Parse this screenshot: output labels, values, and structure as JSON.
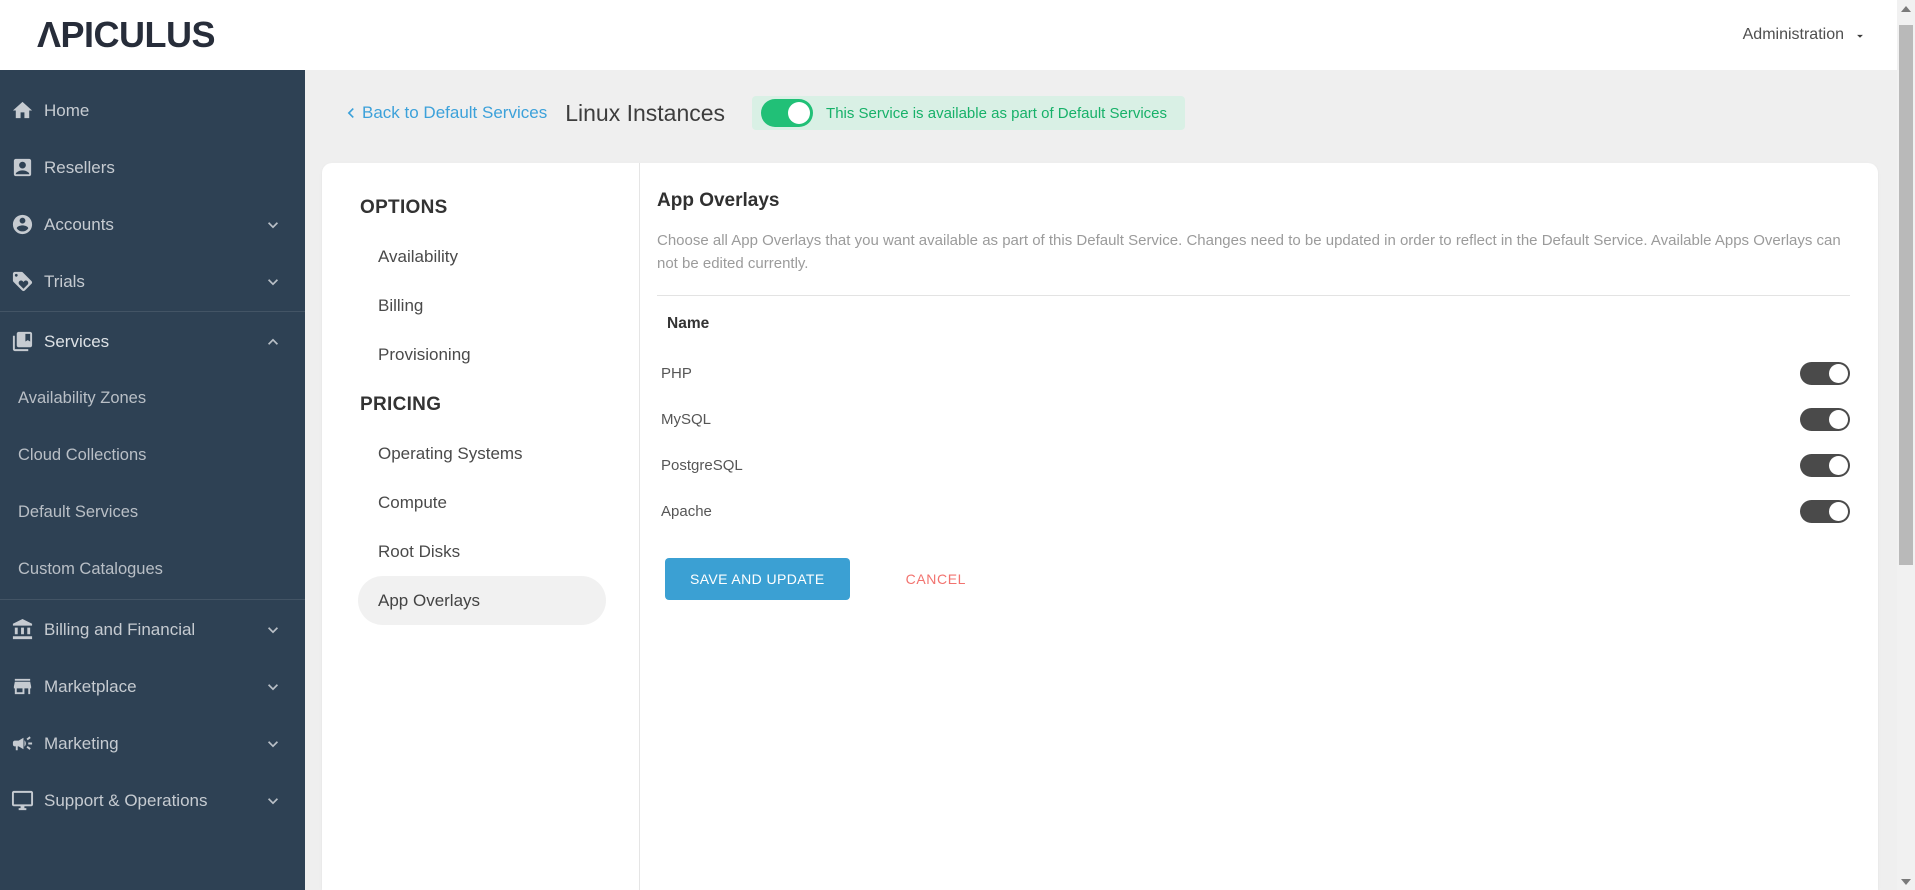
{
  "topbar": {
    "logo": "ΛPICULUS",
    "user_menu": "Administration"
  },
  "sidebar": {
    "items": [
      {
        "label": "Home"
      },
      {
        "label": "Resellers"
      },
      {
        "label": "Accounts"
      },
      {
        "label": "Trials"
      },
      {
        "label": "Services"
      },
      {
        "label": "Availability Zones"
      },
      {
        "label": "Cloud Collections"
      },
      {
        "label": "Default Services"
      },
      {
        "label": "Custom Catalogues"
      },
      {
        "label": "Billing and Financial"
      },
      {
        "label": "Marketplace"
      },
      {
        "label": "Marketing"
      },
      {
        "label": "Support & Operations"
      }
    ],
    "expanded_item": "Services"
  },
  "page_header": {
    "back_link": "Back to Default Services",
    "title": "Linux Instances",
    "service_toggle_label": "This Service is available as part of Default Services",
    "service_toggle_on": true
  },
  "options_panel": {
    "group1_heading": "OPTIONS",
    "group1_items": [
      "Availability",
      "Billing",
      "Provisioning"
    ],
    "group2_heading": "PRICING",
    "group2_items": [
      "Operating Systems",
      "Compute",
      "Root Disks",
      "App Overlays"
    ],
    "selected_item": "App Overlays"
  },
  "main": {
    "title": "App Overlays",
    "description": "Choose all App Overlays that you want available as part of this Default Service. Changes need to be updated in order to reflect in the Default Service. Available Apps Overlays can not be edited currently.",
    "table": {
      "name_header": "Name",
      "rows": [
        {
          "name": "PHP",
          "enabled": true
        },
        {
          "name": "MySQL",
          "enabled": true
        },
        {
          "name": "PostgreSQL",
          "enabled": true
        },
        {
          "name": "Apache",
          "enabled": true
        }
      ]
    },
    "save_button": "SAVE AND UPDATE",
    "cancel_button": "CANCEL"
  },
  "colors": {
    "sidebar_bg": "#2e4154",
    "link_blue": "#3ca1da",
    "button_blue": "#3ba0d3",
    "toggle_green": "#21c077",
    "pill_green_bg": "#d9f0e5",
    "pill_green_text": "#17b169",
    "cancel_red": "#f2736f",
    "toggle_dark": "#4a4a4a"
  }
}
